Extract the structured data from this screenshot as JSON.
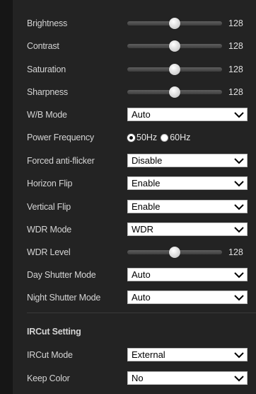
{
  "image_settings": {
    "brightness": {
      "label": "Brightness",
      "value": "128",
      "level": 0.5
    },
    "contrast": {
      "label": "Contrast",
      "value": "128",
      "level": 0.5
    },
    "saturation": {
      "label": "Saturation",
      "value": "128",
      "level": 0.5
    },
    "sharpness": {
      "label": "Sharpness",
      "value": "128",
      "level": 0.5
    },
    "wb_mode": {
      "label": "W/B Mode",
      "selected": "Auto"
    },
    "power_frequency": {
      "label": "Power Frequency",
      "options": [
        "50Hz",
        "60Hz"
      ],
      "selected": "50Hz"
    },
    "forced_anti_flicker": {
      "label": "Forced anti-flicker",
      "selected": "Disable"
    },
    "horizon_flip": {
      "label": "Horizon Flip",
      "selected": "Enable"
    },
    "vertical_flip": {
      "label": "Vertical Flip",
      "selected": "Enable"
    },
    "wdr_mode": {
      "label": "WDR Mode",
      "selected": "WDR"
    },
    "wdr_level": {
      "label": "WDR Level",
      "value": "128",
      "level": 0.5
    },
    "day_shutter_mode": {
      "label": "Day Shutter Mode",
      "selected": "Auto"
    },
    "night_shutter_mode": {
      "label": "Night Shutter Mode",
      "selected": "Auto"
    }
  },
  "ircut": {
    "section_title": "IRCut Setting",
    "mode": {
      "label": "IRCut Mode",
      "selected": "External"
    },
    "keep_color": {
      "label": "Keep Color",
      "selected": "No"
    }
  },
  "colors": {
    "background": "#161616",
    "panel": "#232323",
    "text": "#d4d4d4",
    "select_bg": "#ffffff"
  },
  "icons": {
    "dropdown": "chevron-down-icon",
    "slider": "slider-thumb"
  }
}
